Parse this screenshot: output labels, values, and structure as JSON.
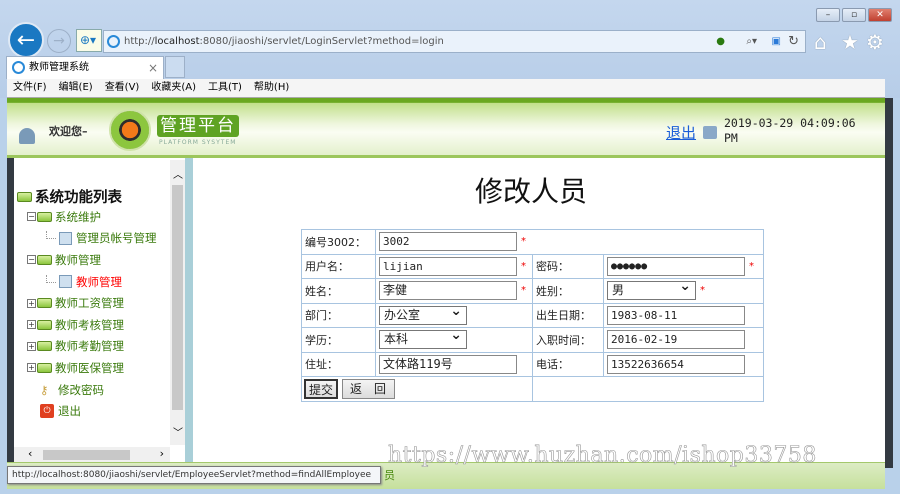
{
  "browser": {
    "url_prefix": "http://",
    "url_host": "localhost",
    "url_rest": ":8080/jiaoshi/servlet/LoginServlet?method=login",
    "tab_title": "教师管理系统",
    "tab_close": "×",
    "menu": [
      "文件(F)",
      "编辑(E)",
      "查看(V)",
      "收藏夹(A)",
      "工具(T)",
      "帮助(H)"
    ],
    "window_buttons": [
      "–",
      "▫",
      "✕"
    ]
  },
  "header": {
    "welcome": "欢迎您–",
    "brand": "管理平台",
    "brand_sub": "PLATFORM SYSYTEM",
    "logout": "退出",
    "datetime": "2019-03-29 04:09:06 PM"
  },
  "sidebar": {
    "root": "系统功能列表",
    "items": [
      {
        "label": "系统维护",
        "type": "folder",
        "expander": "−"
      },
      {
        "label": "管理员帐号管理",
        "type": "leaf"
      },
      {
        "label": "教师管理",
        "type": "folder",
        "expander": "−"
      },
      {
        "label": "教师管理",
        "type": "leaf",
        "active": true
      },
      {
        "label": "教师工资管理",
        "type": "folder",
        "expander": "+"
      },
      {
        "label": "教师考核管理",
        "type": "folder",
        "expander": "+"
      },
      {
        "label": "教师考勤管理",
        "type": "folder",
        "expander": "+"
      },
      {
        "label": "教师医保管理",
        "type": "folder",
        "expander": "+"
      },
      {
        "label": "修改密码",
        "type": "key"
      },
      {
        "label": "退出",
        "type": "exit"
      }
    ],
    "active_color": "#ff0000",
    "item_color": "#3a7a0c"
  },
  "form": {
    "title": "修改人员",
    "id_label": "编号3002：",
    "id_value": "3002",
    "username_label": "用户名：",
    "username_value": "lijian",
    "password_label": "密码：",
    "password_value": "●●●●●●",
    "name_label": "姓名：",
    "name_value": "李健",
    "gender_label": "姓别：",
    "gender_value": "男",
    "dept_label": "部门：",
    "dept_value": "办公室",
    "birth_label": "出生日期：",
    "birth_value": "1983-08-11",
    "edu_label": "学历：",
    "edu_value": "本科",
    "hire_label": "入职时间：",
    "hire_value": "2016-02-19",
    "addr_label": "住址：",
    "addr_value": "文体路119号",
    "phone_label": "电话：",
    "phone_value": "13522636654",
    "required": "*",
    "submit": "提交",
    "back": "返　回"
  },
  "status": {
    "tooltip": "http://localhost:8080/jiaoshi/servlet/EmployeeServlet?method=findAllEmployee",
    "tail": "员"
  },
  "watermark": "https://www.huzhan.com/ishop33758"
}
